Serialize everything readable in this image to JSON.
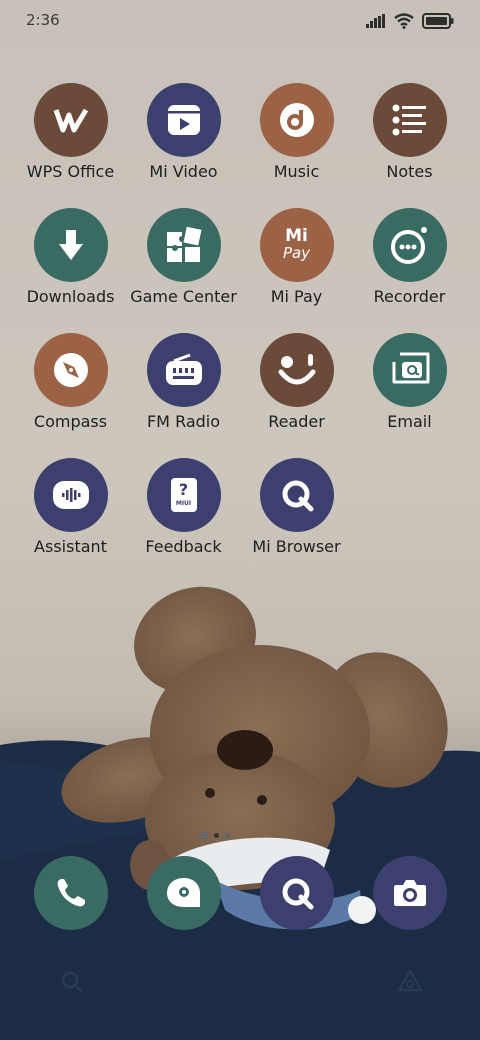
{
  "status_bar": {
    "time": "2:36"
  },
  "apps": [
    {
      "label": "WPS Office",
      "icon": "wps-office-icon",
      "color": "#6b4a3a"
    },
    {
      "label": "Mi Video",
      "icon": "video-play-icon",
      "color": "#3d3f6e"
    },
    {
      "label": "Music",
      "icon": "music-disc-icon",
      "color": "#9b6245"
    },
    {
      "label": "Notes",
      "icon": "notes-list-icon",
      "color": "#6b4a3a"
    },
    {
      "label": "Downloads",
      "icon": "download-arrow-icon",
      "color": "#3a6b62"
    },
    {
      "label": "Game Center",
      "icon": "puzzle-icon",
      "color": "#3a6b62"
    },
    {
      "label": "Mi Pay",
      "icon": "mi-pay-icon",
      "icon_text_top": "Mi",
      "icon_text_bottom": "Pay",
      "color": "#9b6245"
    },
    {
      "label": "Recorder",
      "icon": "recorder-icon",
      "color": "#3a6b62"
    },
    {
      "label": "Compass",
      "icon": "compass-icon",
      "color": "#9b6245"
    },
    {
      "label": "FM Radio",
      "icon": "radio-icon",
      "color": "#3d3f6e"
    },
    {
      "label": "Reader",
      "icon": "reader-smile-icon",
      "color": "#6b4a3a"
    },
    {
      "label": "Email",
      "icon": "email-icon",
      "color": "#3a6b62"
    },
    {
      "label": "Assistant",
      "icon": "assistant-voice-icon",
      "color": "#3d3f6e"
    },
    {
      "label": "Feedback",
      "icon": "feedback-icon",
      "icon_text": "MIUI",
      "color": "#3d3f6e"
    },
    {
      "label": "Mi Browser",
      "icon": "browser-icon",
      "color": "#3d3f6e"
    }
  ],
  "dock": [
    {
      "name": "phone-app",
      "icon": "phone-icon",
      "color": "#3a6b62"
    },
    {
      "name": "messages-app",
      "icon": "messages-icon",
      "color": "#3a6b62"
    },
    {
      "name": "browser-app",
      "icon": "browser-icon",
      "color": "#3d3f6e"
    },
    {
      "name": "camera-app",
      "icon": "camera-icon",
      "color": "#3d3f6e"
    }
  ],
  "page_indicator": {
    "pages": 3,
    "current": 1
  }
}
